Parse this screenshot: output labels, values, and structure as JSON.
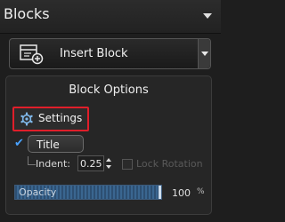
{
  "header": {
    "title": "Blocks",
    "collapse_icon": "chevron-down-icon"
  },
  "insert": {
    "label": "Insert Block",
    "icon": "insert-block-icon",
    "dropdown_icon": "chevron-down-icon"
  },
  "block_options": {
    "title": "Block Options",
    "settings": {
      "label": "Settings",
      "icon": "gear-icon"
    },
    "title_toggle": {
      "label": "Title",
      "checked": true
    },
    "indent": {
      "label": "Indent:",
      "value": "0.25"
    },
    "lock_rotation": {
      "label": "Lock Rotation",
      "enabled": false
    },
    "opacity": {
      "label": "Opacity",
      "value": "100",
      "unit": "%"
    }
  },
  "colors": {
    "highlight": "#e01e2a",
    "accent": "#4aa3ff",
    "slider": "#3a6690"
  }
}
